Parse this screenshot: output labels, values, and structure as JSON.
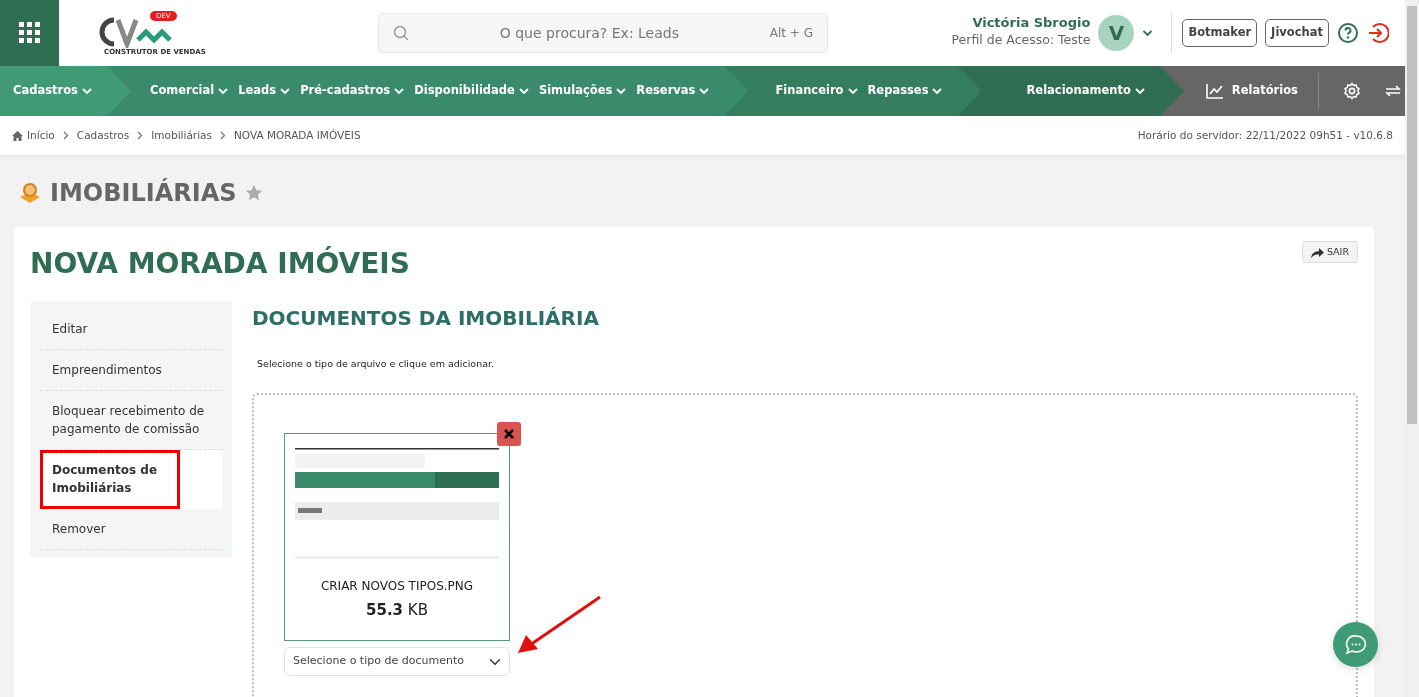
{
  "header": {
    "logo_badge": "DEV",
    "logo_tagline": "CONSTRUTOR DE VENDAS",
    "search": {
      "placeholder": "O que procura? Ex: Leads",
      "shortcut": "Alt + G"
    },
    "user": {
      "name": "Victória Sbrogio",
      "profile": "Perfil de Acesso: Teste",
      "initial": "V"
    },
    "buttons": [
      "Botmaker",
      "Jivochat"
    ]
  },
  "menu": [
    {
      "color": "#409a76",
      "items": [
        "Cadastros"
      ]
    },
    {
      "color": "#3a8b6b",
      "items": [
        "Comercial",
        "Leads",
        "Pré-cadastros",
        "Disponibilidade",
        "Simulações",
        "Reservas"
      ]
    },
    {
      "color": "#347d5f",
      "items": [
        "Financeiro",
        "Repasses"
      ]
    },
    {
      "color": "#2f6e53",
      "items": [
        "Relacionamento"
      ]
    }
  ],
  "reports": "Relatórios",
  "breadcrumb": [
    "Início",
    "Cadastros",
    "Imobiliárias",
    "NOVA MORADA IMÓVEIS"
  ],
  "server_info": "Horário do servidor: 22/11/2022 09h51 - v10.6.8",
  "page_title": "IMOBILIÁRIAS",
  "record_title": "NOVA MORADA IMÓVEIS",
  "exit_button": "SAIR",
  "sidebar": [
    {
      "label": "Editar",
      "selected": false
    },
    {
      "label": "Empreendimentos",
      "selected": false
    },
    {
      "label": "Bloquear recebimento de pagamento de comissão",
      "selected": false
    },
    {
      "label": "Documentos de Imobiliárias",
      "selected": true
    },
    {
      "label": "Remover",
      "selected": false
    }
  ],
  "section_title": "DOCUMENTOS DA IMOBILIÁRIA",
  "hint": "Selecione o tipo de arquivo e clique em adicionar.",
  "documents": [
    {
      "file_name": "CRIAR NOVOS TIPOS.PNG",
      "size_value": "55.3",
      "size_unit": "KB",
      "type_select": {
        "placeholder": "Selecione o tipo de documento"
      }
    }
  ]
}
